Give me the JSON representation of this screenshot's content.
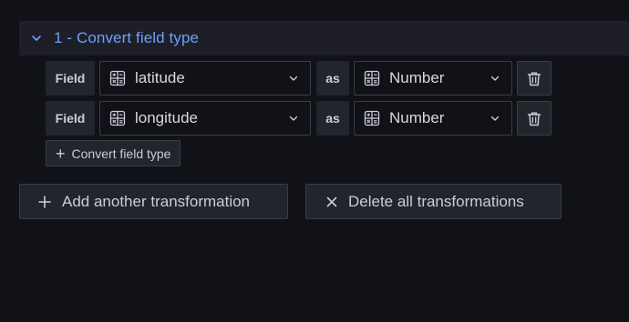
{
  "transformation": {
    "title": "1 - Convert field type",
    "rows": [
      {
        "field_label": "Field",
        "field_value": "latitude",
        "as_label": "as",
        "type_value": "Number"
      },
      {
        "field_label": "Field",
        "field_value": "longitude",
        "as_label": "as",
        "type_value": "Number"
      }
    ],
    "add_conversion_label": "Convert field type"
  },
  "actions": {
    "add_label": "Add another transformation",
    "delete_label": "Delete all transformations"
  },
  "colors": {
    "background": "#111217",
    "header_bg": "#1e1f26",
    "accent": "#6e9fff",
    "panel": "#22252b",
    "border": "#3b3d46"
  },
  "icons": {
    "collapse": "chevron-down-icon",
    "field_type": "field-type-icon",
    "dropdown": "chevron-down-icon",
    "remove": "trash-icon",
    "add": "plus-icon",
    "delete": "close-icon"
  }
}
